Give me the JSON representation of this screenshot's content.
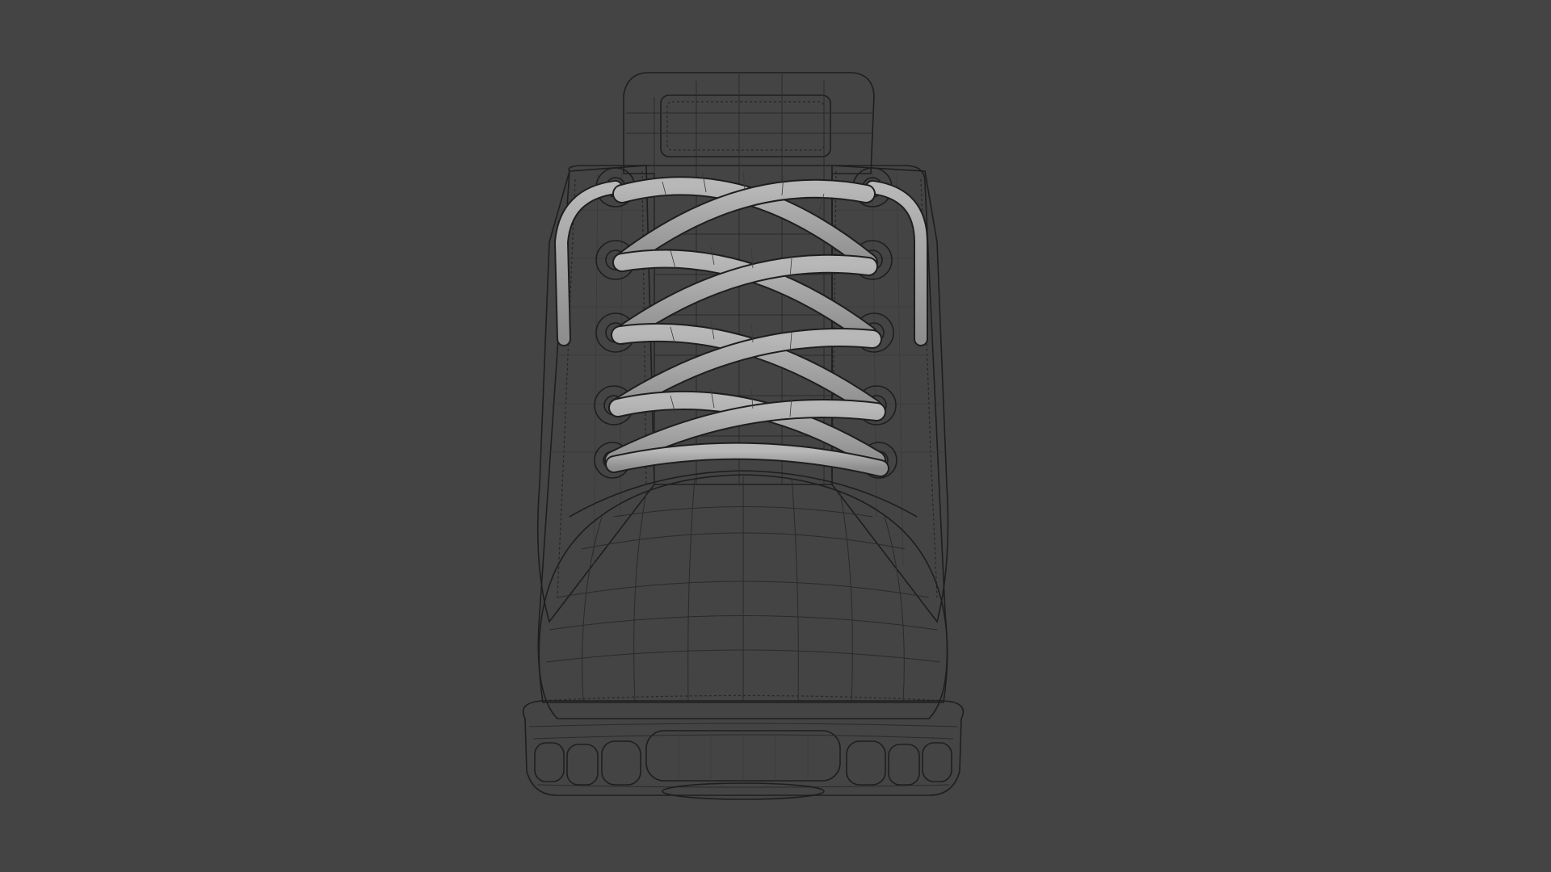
{
  "viewport": {
    "background_color": "#444444",
    "model_color": "#a6a6a6",
    "wire_color": "#2a2a2a",
    "shading_mode": "wireframe-on-shaded"
  },
  "model": {
    "subject": "boot",
    "view": "front"
  }
}
